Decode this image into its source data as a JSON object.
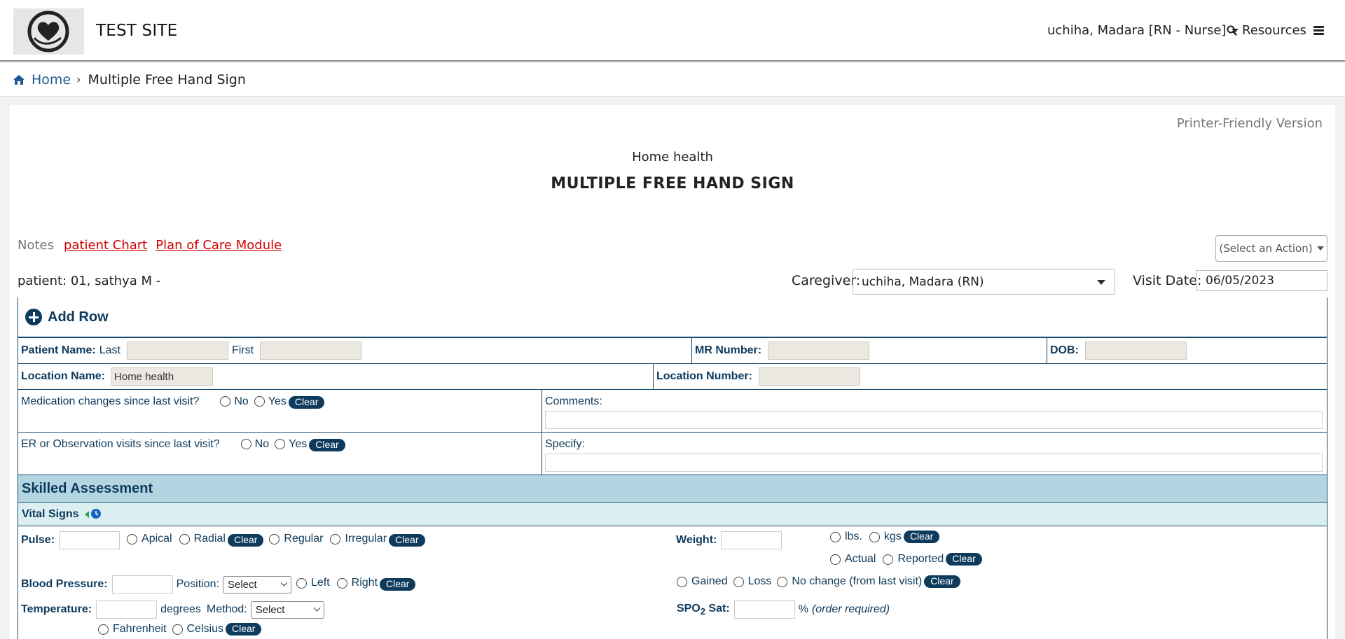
{
  "header": {
    "site_title": "TEST SITE",
    "user": "uchiha, Madara [RN - Nurse]",
    "resources_label": "Resources"
  },
  "breadcrumb": {
    "home": "Home",
    "current": "Multiple Free Hand Sign"
  },
  "page": {
    "printer_link": "Printer-Friendly Version",
    "subtitle": "Home health",
    "title": "MULTIPLE FREE HAND SIGN",
    "notes_label": "Notes",
    "patient_chart_link": "patient Chart",
    "plan_of_care_link": "Plan of Care Module",
    "action_select": "(Select an Action)",
    "patient_line": "patient: 01, sathya M -",
    "caregiver_label": "Caregiver:",
    "caregiver_value": "uchiha, Madara (RN)",
    "visit_date_label": "Visit Date:",
    "visit_date_value": "06/05/2023"
  },
  "form": {
    "add_row": "Add Row",
    "patient_name_label": "Patient Name:",
    "last_label": "Last",
    "first_label": "First",
    "mr_number_label": "MR Number:",
    "dob_label": "DOB:",
    "location_name_label": "Location Name:",
    "location_name_value": "Home health",
    "location_number_label": "Location Number:",
    "med_changes_q": "Medication changes since last visit?",
    "no": "No",
    "yes": "Yes",
    "clear": "Clear",
    "comments_label": "Comments:",
    "er_visits_q": "ER or Observation visits since last visit?",
    "specify_label": "Specify:",
    "skilled_assessment": "Skilled Assessment",
    "vital_signs": "Vital Signs",
    "pulse_label": "Pulse:",
    "apical": "Apical",
    "radial": "Radial",
    "regular": "Regular",
    "irregular": "Irregular",
    "weight_label": "Weight:",
    "lbs": "lbs.",
    "kgs": "kgs",
    "actual": "Actual",
    "reported": "Reported",
    "gained": "Gained",
    "loss": "Loss",
    "no_change": "No change (from last visit)",
    "bp_label": "Blood Pressure:",
    "position_label": "Position:",
    "select": "Select",
    "left": "Left",
    "right": "Right",
    "temp_label": "Temperature:",
    "degrees": "degrees",
    "method_label": "Method:",
    "spo2_label": "SPO",
    "spo2_sub": "2",
    "spo2_suffix": "Sat:",
    "percent": "%",
    "order_required": "(order required)",
    "fahrenheit": "Fahrenheit",
    "celsius": "Celsius"
  },
  "colors": {
    "accent": "#0e3a5c",
    "section_bg": "#b3d5e1",
    "subsection_bg": "#dbeef2",
    "link_red": "#d10000"
  }
}
